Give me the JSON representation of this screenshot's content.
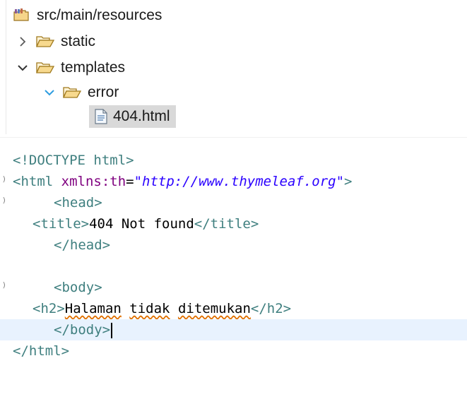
{
  "tree": {
    "root": "src/main/resources",
    "items": [
      {
        "label": "static",
        "expanded": false
      },
      {
        "label": "templates",
        "expanded": true
      },
      {
        "label": "error",
        "expanded": true
      },
      {
        "label": "404.html",
        "selected": true
      }
    ]
  },
  "editor": {
    "lines": [
      {
        "parts": [
          "<!DOCTYPE ",
          "html",
          ">"
        ]
      },
      {
        "parts": [
          "<html ",
          "xmlns:th",
          "=",
          "\"http://www.thymeleaf.org\"",
          ">"
        ]
      },
      {
        "parts": [
          "<head>"
        ]
      },
      {
        "parts": [
          "<title>",
          "404 Not found",
          "</title>"
        ]
      },
      {
        "parts": [
          "</head>"
        ]
      },
      {
        "parts": [
          ""
        ]
      },
      {
        "parts": [
          "<body>"
        ]
      },
      {
        "parts": [
          "<h2>",
          "Halaman",
          " ",
          "tidak",
          " ",
          "ditemukan",
          "</h2>"
        ]
      },
      {
        "parts": [
          "</body>"
        ]
      },
      {
        "parts": [
          "</html>"
        ]
      }
    ]
  },
  "colors": {
    "tag": "#3f7f7f",
    "attribute": "#7f007f",
    "string": "#2a00ff",
    "current_line": "#e8f2fe",
    "selection": "#d9d9d9"
  }
}
